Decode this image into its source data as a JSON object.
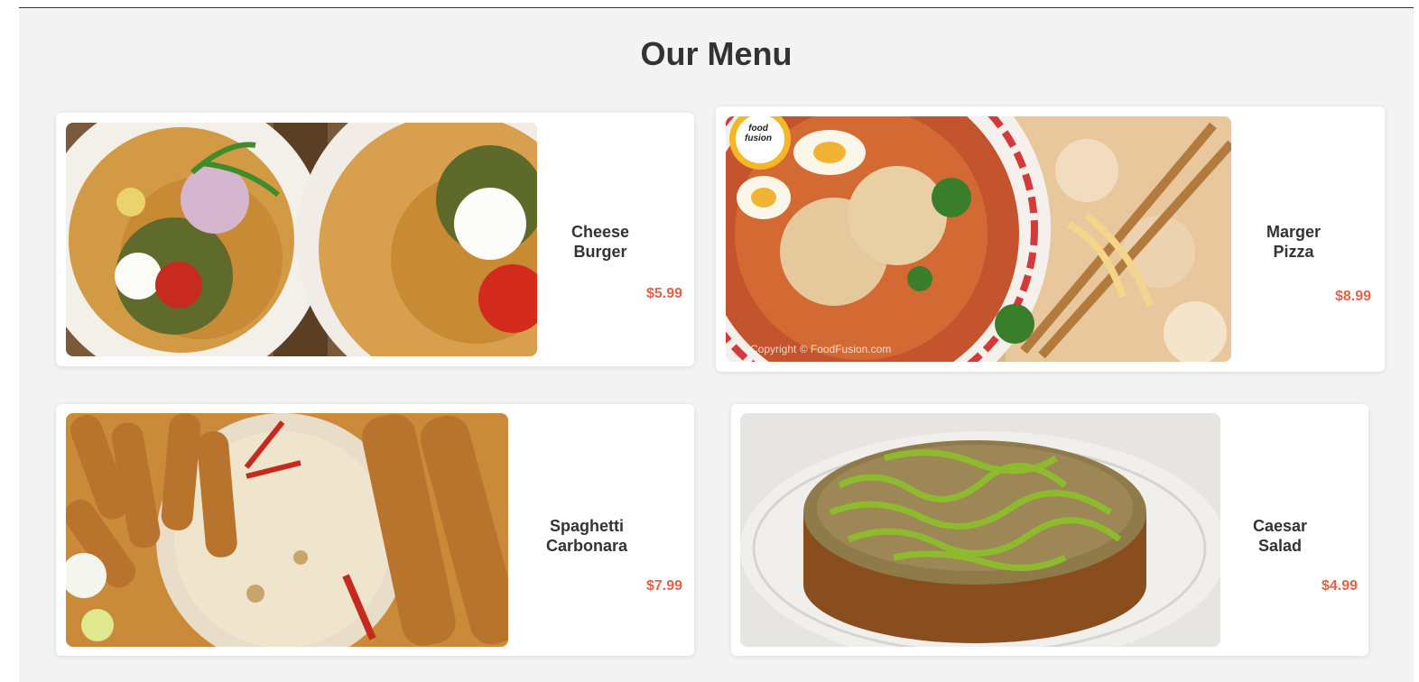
{
  "page": {
    "title": "Our Menu"
  },
  "items": [
    {
      "name": "Cheese\nBurger",
      "price": "$5.99"
    },
    {
      "name": "Marger\nPizza",
      "price": "$8.99",
      "watermark": "Copyright © FoodFusion.com",
      "logo_text": "food fusion"
    },
    {
      "name": "Spaghetti\nCarbonara",
      "price": "$7.99"
    },
    {
      "name": "Caesar\nSalad",
      "price": "$4.99"
    }
  ],
  "colors": {
    "price": "#e0634a",
    "background": "#f3f3f3",
    "card": "#ffffff",
    "heading": "#333333"
  }
}
